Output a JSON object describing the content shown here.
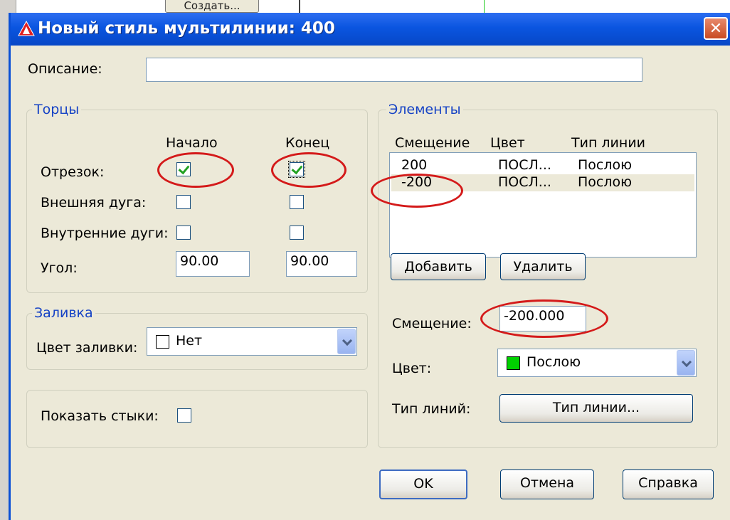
{
  "background": {
    "create_button": "Создать..."
  },
  "dialog": {
    "title": "Новый стиль мультилинии: 400",
    "close_glyph": "✕",
    "description_label": "Описание:",
    "description_value": ""
  },
  "caps": {
    "legend": "Торцы",
    "col_start": "Начало",
    "col_end": "Конец",
    "rows": [
      {
        "label": "Отрезок:",
        "start_checked": true,
        "end_checked": true
      },
      {
        "label": "Внешняя дуга:",
        "start_checked": false,
        "end_checked": false
      },
      {
        "label": "Внутренние дуги:",
        "start_checked": false,
        "end_checked": false
      }
    ],
    "angle_label": "Угол:",
    "angle_start": "90.00",
    "angle_end": "90.00"
  },
  "fill": {
    "legend": "Заливка",
    "color_label": "Цвет заливки:",
    "color_value": "Нет",
    "color_swatch": "#ffffff"
  },
  "joints": {
    "label": "Показать стыки:",
    "checked": false
  },
  "elements": {
    "legend": "Элементы",
    "headers": [
      "Смещение",
      "Цвет",
      "Тип линии"
    ],
    "rows": [
      {
        "offset": "200",
        "color": "ПОСЛ...",
        "linetype": "Послою"
      },
      {
        "offset": "-200",
        "color": "ПОСЛ...",
        "linetype": "Послою"
      }
    ],
    "add_button": "Добавить",
    "delete_button": "Удалить",
    "offset_label": "Смещение:",
    "offset_value": "-200.000",
    "color_label": "Цвет:",
    "color_value": "Послою",
    "color_swatch": "#00d100",
    "linetype_label": "Тип линий:",
    "linetype_button": "Тип линии..."
  },
  "footer": {
    "ok": "OK",
    "cancel": "Отмена",
    "help": "Справка"
  },
  "colors": {
    "annotation": "#d41a1a",
    "titlebar": "#0a55e0",
    "legend_text": "#1542c5"
  }
}
